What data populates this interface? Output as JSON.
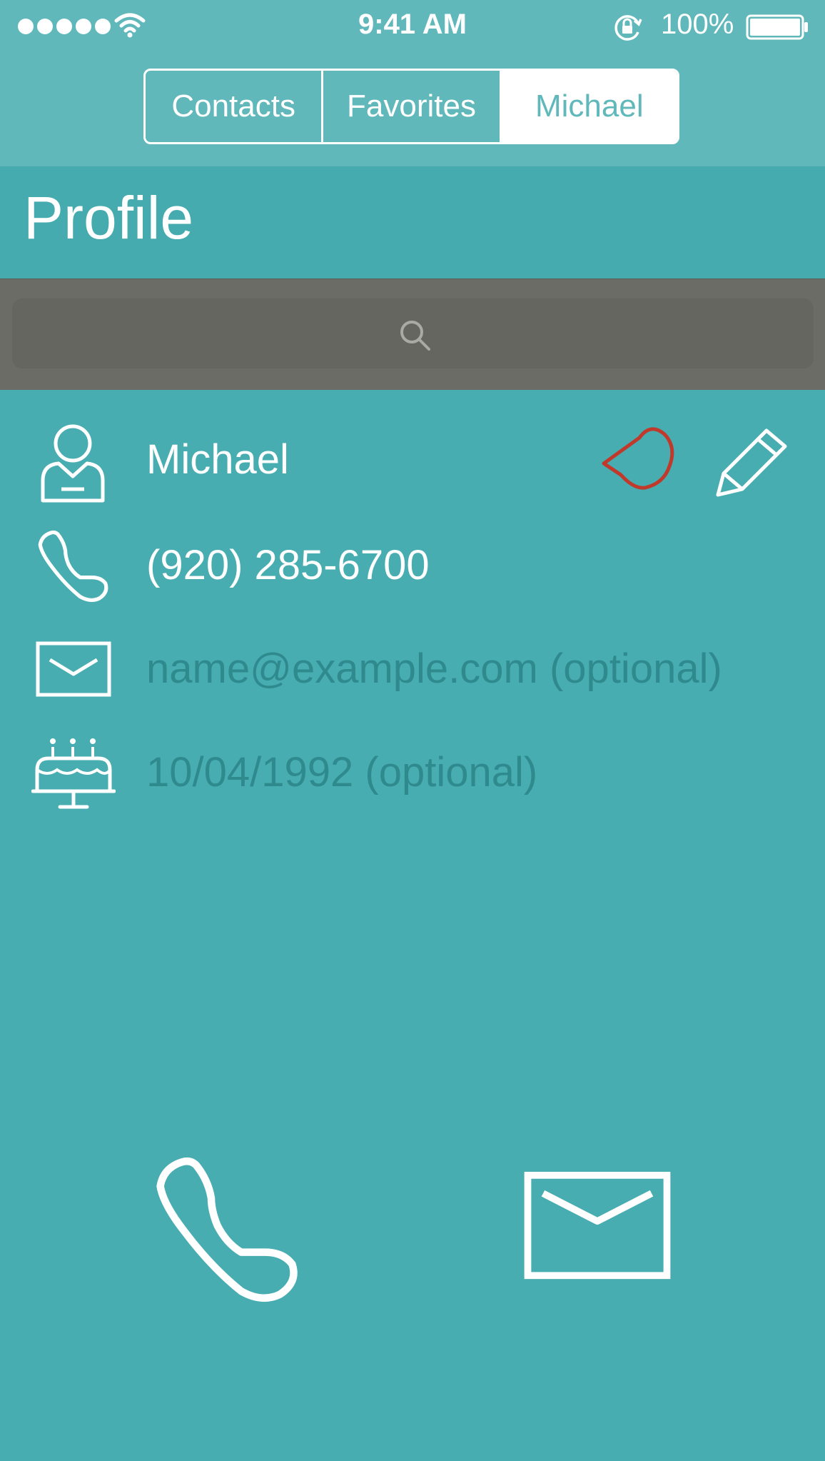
{
  "status_bar": {
    "time": "9:41 AM",
    "battery_percent": "100%",
    "signal_dots": 5,
    "icons": [
      "signal-dots-icon",
      "wifi-icon",
      "rotation-lock-icon",
      "battery-icon"
    ]
  },
  "segmented_control": {
    "items": [
      {
        "label": "Contacts",
        "active": false
      },
      {
        "label": "Favorites",
        "active": false
      },
      {
        "label": "Michael",
        "active": true
      }
    ]
  },
  "header": {
    "title": "Profile"
  },
  "search": {
    "placeholder": "",
    "icon": "search-icon"
  },
  "profile": {
    "name": "Michael",
    "phone": "(920) 285-6700",
    "email_placeholder": "name@example.com (optional)",
    "birthday_placeholder": "10/04/1992 (optional)",
    "icons": [
      "person-icon",
      "heart-icon",
      "pencil-icon",
      "phone-icon",
      "mail-icon",
      "birthday-cake-icon"
    ]
  },
  "actions": {
    "icons": [
      "call-button-icon",
      "email-button-icon"
    ]
  },
  "colors": {
    "background": "#47adb1",
    "topbar": "#60b8bb",
    "search_bar": "#6c6c66",
    "favorite_heart": "#c0392b",
    "placeholder_text": "#2f8a8e"
  }
}
